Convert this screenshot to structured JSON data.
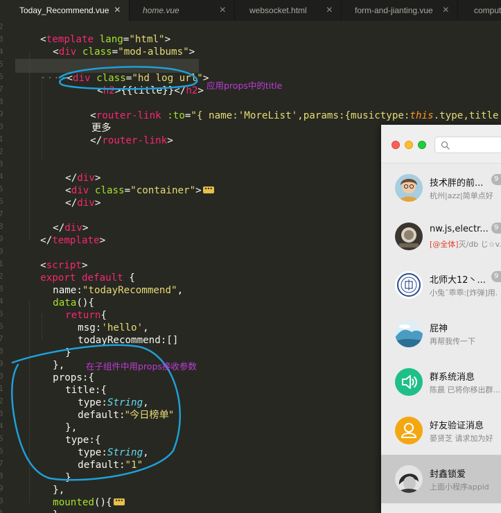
{
  "tabs": [
    {
      "label": "Today_Recommend.vue",
      "active": true,
      "italic": false
    },
    {
      "label": "home.vue",
      "active": false,
      "italic": true
    },
    {
      "label": "websocket.html",
      "active": false,
      "italic": false
    },
    {
      "label": "form-and-jianting.vue",
      "active": false,
      "italic": false
    },
    {
      "label": "comput",
      "active": false,
      "italic": false
    }
  ],
  "tab_close_glyph": "×",
  "code": {
    "l1_open": "<",
    "l1_tag": "template",
    "l1_sp": " ",
    "l1_attr": "lang",
    "l1_eq": "=",
    "l1_val": "\"html\"",
    "l1_close": ">",
    "l2_open": "<",
    "l2_tag": "div",
    "l2_sp": " ",
    "l2_attr": "class",
    "l2_eq": "=",
    "l2_val": "\"mod-albums\"",
    "l2_close": ">",
    "l3_dots": "····",
    "l3_open": "<",
    "l3_tag": "div",
    "l3_sp": " ",
    "l3_attr": "class",
    "l3_eq": "=",
    "l3_val": "\"hd log url\"",
    "l3_close": ">",
    "l4_open": "<",
    "l4_tag": "h2",
    "l4_mid": ">{{title}}</",
    "l4_tag2": "h2",
    "l4_close": ">",
    "l5_open": "<",
    "l5_tag": "router-link",
    "l5_sp": " ",
    "l5_attr": ":to",
    "l5_eq": "=",
    "l5_v1": "\"{ name:",
    "l5_v2": "'MoreList'",
    "l5_v3": ",params:{musictype:",
    "l5_this": "this",
    "l5_v4": ".type,title:",
    "l6_text": "更多",
    "l7_open": "</",
    "l7_tag": "router-link",
    "l7_close": ">",
    "l8_open": "</",
    "l8_tag": "div",
    "l8_close": ">",
    "l9_open": "<",
    "l9_tag": "div",
    "l9_sp": " ",
    "l9_attr": "class",
    "l9_eq": "=",
    "l9_val": "\"container\"",
    "l9_close": ">",
    "l10_open": "</",
    "l10_tag": "div",
    "l10_close": ">",
    "l11_open": "</",
    "l11_tag": "div",
    "l11_close": ">",
    "l12_open": "</",
    "l12_tag": "template",
    "l12_close": ">",
    "l13_open": "<",
    "l13_tag": "script",
    "l13_close": ">",
    "l14_kw1": "export",
    "l14_sp": " ",
    "l14_kw2": "default",
    "l14_rest": " {",
    "l15_key": "name:",
    "l15_val": "\"todayRecommend\"",
    "l15_rest": ",",
    "l16_fn": "data",
    "l16_rest": "(){",
    "l17_kw": "return",
    "l17_rest": "{",
    "l18_key": "msg:",
    "l18_val": "'hello'",
    "l18_rest": ",",
    "l19_text": "todayRecommend:[]",
    "l20_text": "}",
    "l21_text": "},",
    "l22_text": "props:{",
    "l23_text": "title:{",
    "l24_key": "type:",
    "l24_type": "String",
    "l24_rest": ",",
    "l25_key": "default:",
    "l25_val": "\"今日榜单\"",
    "l26_text": "},",
    "l27_text": "type:{",
    "l28_key": "type:",
    "l28_type": "String",
    "l28_rest": ",",
    "l29_key": "default:",
    "l29_val": "\"1\"",
    "l30_text": "}",
    "l31_text": "},",
    "l32_fn": "mounted",
    "l32_rest": "(){",
    "l33_text": "},"
  },
  "annotations": {
    "props_title": "应用props中的title",
    "props_receive": "在子组件中用props接收参数"
  },
  "colors": {
    "annotation": "#c03bd9",
    "circle": "#1fa0d8",
    "tag": "#f92672",
    "attr": "#a6e22e",
    "string": "#e6db74",
    "type": "#66d9ef"
  },
  "chat": {
    "conversations": [
      {
        "name": "技术胖的前...",
        "preview": "杭州|azz|简单点好",
        "badge": "9",
        "avatar": "person-photo-icon",
        "selected": false
      },
      {
        "name": "nw.js,electr...",
        "preview_mention": "[@全体]",
        "preview": "灭/db じ☆v.",
        "badge": "9",
        "avatar": "group-photo-icon",
        "selected": false
      },
      {
        "name": "北师大12丶...",
        "preview": "小兔¯乖乖:[炸弹]用.",
        "badge": "9",
        "avatar": "university-seal-icon",
        "selected": false
      },
      {
        "name": "屁神",
        "preview": "再帮我传一下",
        "badge": "",
        "avatar": "landscape-photo-icon",
        "selected": false
      },
      {
        "name": "群系统消息",
        "preview": "陈晨 已将你移出群...",
        "badge": "",
        "avatar": "speaker-icon",
        "selected": false
      },
      {
        "name": "好友验证消息",
        "preview": "晏贤芝 请求加为好",
        "badge": "",
        "avatar": "user-icon",
        "selected": false
      },
      {
        "name": "封鑫锁爱",
        "preview": "上面小程序appid",
        "badge": "",
        "avatar": "portrait-photo-icon",
        "selected": true
      }
    ]
  }
}
